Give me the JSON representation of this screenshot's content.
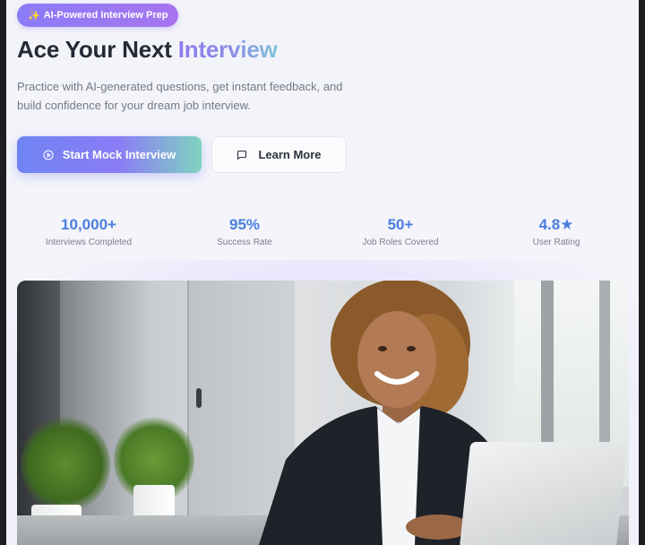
{
  "badge": {
    "icon": "sparkles-icon",
    "label": "AI-Powered Interview Prep"
  },
  "headline": {
    "prefix": "Ace Your Next ",
    "accent": "Interview"
  },
  "subtitle": "Practice with AI-generated questions, get instant feedback, and build confidence for your dream job interview.",
  "actions": {
    "primary": {
      "label": "Start Mock Interview",
      "icon": "play-circle-icon"
    },
    "secondary": {
      "label": "Learn More",
      "icon": "message-square-icon"
    }
  },
  "stats": [
    {
      "value": "10,000+",
      "label": "Interviews Completed"
    },
    {
      "value": "95%",
      "label": "Success Rate"
    },
    {
      "value": "50+",
      "label": "Job Roles Covered"
    },
    {
      "value": "4.8★",
      "label": "User Rating"
    }
  ],
  "colors": {
    "accent_blue": "#4b7ee0",
    "accent_purple": "#8b7cf6",
    "accent_teal": "#7fd3c0",
    "text_dark": "#252a37"
  }
}
